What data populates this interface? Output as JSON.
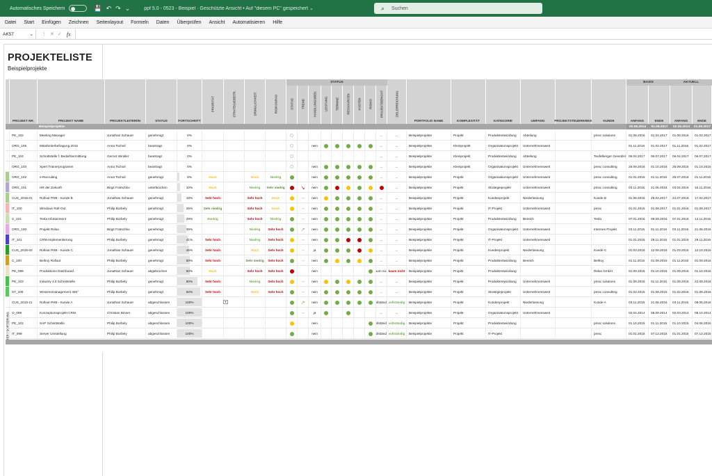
{
  "titlebar": {
    "autosave_label": "Automatisches Speichern",
    "document_title": "ppf 5.0 - 0523 - Beispiel · Geschützte Ansicht • Auf \"diesem PC\" gespeichert ⌄",
    "search_placeholder": "Suchen"
  },
  "ribbon_tabs": [
    "Datei",
    "Start",
    "Einfügen",
    "Zeichnen",
    "Seitenlayout",
    "Formeln",
    "Daten",
    "Überprüfen",
    "Ansicht",
    "Automatisieren",
    "Hilfe"
  ],
  "formula_bar": {
    "name_box": "AK57",
    "fx": "fx",
    "value": ""
  },
  "sheet": {
    "title": "PROJEKTELISTE",
    "subtitle": "Beispielprojekte"
  },
  "header": {
    "group_status": "STATUS",
    "group_basis": "BASIS",
    "group_aktuell": "AKTUELL",
    "vertical": {
      "filter": "FILTER / SORTIERUNG",
      "prioritaet": "PRIORITÄT",
      "strategie": "STRATEGIEBEITR.",
      "dringlichkeit": "DRINGLICHKEIT",
      "risiko": "RISIKOGRAD",
      "status": "STATUS",
      "trend": "TREND",
      "handlungsbedarf": "HANDLUNGSBED.",
      "leistung": "LEISTUNG",
      "termine": "TERMINE",
      "ressourcen": "RESSOURCEN",
      "kosten": "KOSTEN",
      "risiko2": "RISIKO",
      "projektbericht": "PROJEKTBERICHT",
      "zielerreichung": "ZIELERREICHUNG"
    },
    "cols": {
      "nr": "PROJEKT NR.",
      "name": "PROJEKT NAME",
      "leiter": "PROJEKTLEITER/IN",
      "status": "STATUS",
      "fortschritt": "FORTSCHRITT",
      "portfolio": "PORTFOLIO NAME",
      "komplexitaet": "KOMPLEXITÄT",
      "kategorie": "KATEGORIE",
      "umfang": "UMFANG",
      "steuerkreis": "PROJEKTSTEUERKREIS",
      "kunde": "KUNDE",
      "anfang1": "ANFANG",
      "ende1": "ENDE",
      "anfang2": "ANFANG",
      "ende2": "ENDE"
    },
    "dates": {
      "basis_start": "02.05.2014",
      "basis_end": "01.09.2017",
      "akt_start": "02.05.2014",
      "akt_end": "01.09.2017"
    }
  },
  "group_row_label": "Beispielprojekte",
  "colors": {
    "green": "#70ad47",
    "yellow": "#ffc000",
    "red": "#c00000",
    "excel_green": "#217346"
  },
  "rows": [
    {
      "strip": "",
      "nr": "PE_102",
      "name": "Meeting Manager",
      "leiter": "Jonathan Schauer",
      "status": "genehmigt",
      "fs": "0%",
      "fsv": 0,
      "prio": "",
      "strat": "",
      "dring": "",
      "risk": "",
      "st": "ring",
      "trend": "",
      "hb": "",
      "l": "",
      "t": "",
      "r": "",
      "k": "",
      "ri": "",
      "pb": "...",
      "ze": "",
      "port": "Beispielprojekte",
      "komp": "Projekt",
      "kat": "Produktentwicklung",
      "umf": "Abteilung",
      "psk": "",
      "kunde": "pmsc solutions",
      "a1": "01.08.2016",
      "e1": "01.04.2017",
      "a2": "01.08.2016",
      "e2": "01.04.2017"
    },
    {
      "strip": "",
      "nr": "ORG_105",
      "name": "Mitarbeiterbefragung 2016",
      "leiter": "Anna Tschoil",
      "status": "beantragt",
      "fs": "0%",
      "fsv": 0,
      "prio": "",
      "strat": "",
      "dring": "",
      "risk": "",
      "st": "ring",
      "trend": "",
      "hb": "nein",
      "l": "g",
      "t": "g",
      "r": "g",
      "k": "g",
      "ri": "g",
      "pb": "...",
      "ze": "",
      "port": "Beispielprojekte",
      "komp": "Kleinprojekt",
      "kat": "Organisationsprojekt",
      "umf": "Unternehmensweit",
      "psk": "",
      "kunde": "",
      "a1": "01.11.2016",
      "e1": "01.02.2017",
      "a2": "01.11.2016",
      "e2": "01.02.2017"
    },
    {
      "strip": "",
      "nr": "PE_104",
      "name": "Schnittstelle f. Bedarfsermittlung",
      "leiter": "Gernot Winkler",
      "status": "beantragt",
      "fs": "0%",
      "fsv": 0,
      "prio": "",
      "strat": "",
      "dring": "",
      "risk": "",
      "st": "ring",
      "trend": "",
      "hb": "",
      "l": "",
      "t": "",
      "r": "",
      "k": "",
      "ri": "",
      "pb": "...",
      "ze": "",
      "port": "Beispielprojekte",
      "komp": "Kleinprojekt",
      "kat": "Produktentwicklung",
      "umf": "Abteilung",
      "psk": "",
      "kunde": "Teufelberger GesmbH",
      "a1": "06.04.2017",
      "e1": "06.07.2017",
      "a2": "06.04.2017",
      "e2": "06.07.2017"
    },
    {
      "strip": "",
      "nr": "ORG_103",
      "name": "Xpert Trainerprogramm",
      "leiter": "Anna Tschoil",
      "status": "beantragt",
      "fs": "0%",
      "fsv": 0,
      "prio": "",
      "strat": "",
      "dring": "",
      "risk": "",
      "st": "ring",
      "trend": "",
      "hb": "nein",
      "l": "g",
      "t": "g",
      "r": "g",
      "k": "g",
      "ri": "g",
      "pb": "...",
      "ze": "",
      "port": "Beispielprojekte",
      "komp": "Kleinprojekt",
      "kat": "Organisationsprojekt",
      "umf": "Unternehmensweit",
      "psk": "",
      "kunde": "pmsc consulting",
      "a1": "25.09.2016",
      "e1": "01.10.2016",
      "a2": "25.09.2016",
      "e2": "01.10.2016"
    },
    {
      "strip": "#a9d08e",
      "nr": "ORG_102",
      "name": "e-Recruiting",
      "leiter": "Anna Tschoil",
      "status": "genehmigt",
      "fs": "8%",
      "fsv": 8,
      "prio": "Hoch",
      "strat": "",
      "dring": "Hoch",
      "risk": "Niedrig",
      "st": "g",
      "trend": "",
      "hb": "nein",
      "l": "g",
      "t": "g",
      "r": "g",
      "k": "g",
      "ri": "g",
      "pb": "...",
      "ze": "",
      "port": "Beispielprojekte",
      "komp": "Projekt",
      "kat": "Organisationsprojekt",
      "umf": "Unternehmensweit",
      "psk": "",
      "kunde": "pmsc consulting",
      "a1": "01.01.2016",
      "e1": "01.11.2016",
      "a2": "25.07.2016",
      "e2": "01.11.2016"
    },
    {
      "strip": "#b4a7d6",
      "nr": "ORG_101",
      "name": "HR der Zukunft",
      "leiter": "Birgit Fratschko",
      "status": "unterbrochen",
      "fs": "10%",
      "fsv": 10,
      "prio": "Hoch",
      "strat": "",
      "dring": "Niedrig",
      "risk": "Sehr niedrig",
      "st": "r",
      "trend": "↘",
      "hb": "nein",
      "l": "g",
      "t": "r",
      "r": "y",
      "k": "g",
      "ri": "y",
      "pb": "r",
      "ze": "",
      "port": "Beispielprojekte",
      "komp": "Projekt",
      "kat": "Strategieprojekt",
      "umf": "Unternehmensweit",
      "psk": "",
      "kunde": "pmsc consulting",
      "a1": "03.11.2015",
      "e1": "21.06.2016",
      "a2": "03.04.2016",
      "e2": "16.11.2016"
    },
    {
      "strip": "#a9d08e",
      "nr": "CUS_2016-01",
      "name": "Rollout PHB - Kunde B",
      "leiter": "Jonathan Schauer",
      "status": "genehmigt",
      "fs": "18%",
      "fsv": 18,
      "prio": "Sehr hoch",
      "strat": "",
      "dring": "Sehr hoch",
      "risk": "Hoch",
      "st": "y",
      "trend": "→",
      "hb": "nein",
      "l": "y",
      "t": "g",
      "r": "g",
      "k": "g",
      "ri": "g",
      "pb": "...",
      "ze": "",
      "port": "Beispielprojekte",
      "komp": "Projekt",
      "kat": "Kundenprojekt",
      "umf": "Niederlassung",
      "psk": "",
      "kunde": "Kunde B",
      "a1": "01.08.2016",
      "e1": "25.02.2017",
      "a2": "24.07.2016",
      "e2": "17.02.2017"
    },
    {
      "strip": "#f4b6b6",
      "nr": "IT_100",
      "name": "Windows Roll-Out",
      "leiter": "Philip Borbely",
      "status": "genehmigt",
      "fs": "26%",
      "fsv": 26,
      "prio": "Sehr niedrig",
      "strat": "",
      "dring": "Sehr hoch",
      "risk": "Hoch",
      "st": "y",
      "trend": "→",
      "hb": "nein",
      "l": "g",
      "t": "g",
      "r": "g",
      "k": "g",
      "ri": "g",
      "pb": "...",
      "ze": "",
      "port": "Beispielprojekte",
      "komp": "Projekt",
      "kat": "IT-Projekt",
      "umf": "Unternehmensweit",
      "psk": "",
      "kunde": "pmsc",
      "a1": "01.01.2016",
      "e1": "01.09.2017",
      "a2": "01.01.2016",
      "e2": "01.09.2017"
    },
    {
      "strip": "#c6e0b4",
      "nr": "C_101",
      "name": "Tesla Infotainment",
      "leiter": "Philip Borbely",
      "status": "genehmigt",
      "fs": "29%",
      "fsv": 29,
      "prio": "Niedrig",
      "strat": "",
      "dring": "Sehr hoch",
      "risk": "Niedrig",
      "st": "g",
      "trend": "→",
      "hb": "nein",
      "l": "g",
      "t": "g",
      "r": "g",
      "k": "g",
      "ri": "g",
      "pb": "...",
      "ze": "",
      "port": "Beispielprojekte",
      "komp": "Projekt",
      "kat": "Produktentwicklung",
      "umf": "Bereich",
      "psk": "",
      "kunde": "Tesla",
      "a1": "07.01.2016",
      "e1": "09.09.2016",
      "a2": "07.01.2016",
      "e2": "14.11.2016"
    },
    {
      "strip": "#e6a8e6",
      "nr": "ORG_100",
      "name": "Projekt Relax",
      "leiter": "Birgit Fratschko",
      "status": "genehmigt",
      "fs": "36%",
      "fsv": 36,
      "prio": "",
      "strat": "",
      "dring": "Niedrig",
      "risk": "Sehr hoch",
      "st": "g",
      "trend": "↗",
      "hb": "nein",
      "l": "g",
      "t": "g",
      "r": "g",
      "k": "g",
      "ri": "g",
      "pb": "...",
      "ze": "",
      "port": "Beispielprojekte",
      "komp": "Projekt",
      "kat": "Organisationsprojekt",
      "umf": "Unternehmensweit",
      "psk": "",
      "kunde": "Internes Projekt",
      "a1": "03.11.2015",
      "e1": "01.11.2016",
      "a2": "03.11.2015",
      "e2": "21.06.2016"
    },
    {
      "strip": "#4b3fd4",
      "nr": "IT_101",
      "name": "CRM-Implementierung",
      "leiter": "Philip Borbely",
      "status": "genehmigt",
      "fs": "41%",
      "fsv": 41,
      "prio": "Sehr hoch",
      "strat": "",
      "dring": "Niedrig",
      "risk": "Sehr hoch",
      "st": "y",
      "trend": "→",
      "hb": "nein",
      "l": "g",
      "t": "g",
      "r": "r",
      "k": "r",
      "ri": "g",
      "pb": "...",
      "ze": "",
      "port": "Beispielprojekte",
      "komp": "Projekt",
      "kat": "IT-Projekt",
      "umf": "Unternehmensweit",
      "psk": "",
      "kunde": "",
      "a1": "01.01.2016",
      "e1": "29.11.2016",
      "a2": "01.01.2016",
      "e2": "29.11.2016"
    },
    {
      "strip": "#2a9d2a",
      "nr": "CUS_2016-02",
      "name": "Rollout PHB - Kunde C",
      "leiter": "Jonathan Schauer",
      "status": "genehmigt",
      "fs": "46%",
      "fsv": 46,
      "prio": "Sehr hoch",
      "strat": "",
      "dring": "Hoch",
      "risk": "Sehr hoch",
      "st": "y",
      "trend": "→",
      "hb": "ja",
      "l": "g",
      "t": "g",
      "r": "g",
      "k": "r",
      "ri": "y",
      "pb": "...",
      "ze": "",
      "port": "Beispielprojekte",
      "komp": "Projekt",
      "kat": "Kundenprojekt",
      "umf": "Niederlassung",
      "psk": "",
      "kunde": "Kunde C",
      "a1": "01.03.2016",
      "e1": "12.09.2016",
      "a2": "01.03.2016",
      "e2": "12.10.2016"
    },
    {
      "strip": "#c9a227",
      "nr": "C_100",
      "name": "Bellroy Rollout",
      "leiter": "Philip Borbely",
      "status": "genehmigt",
      "fs": "50%",
      "fsv": 50,
      "prio": "Sehr hoch",
      "strat": "",
      "dring": "Sehr niedrig",
      "risk": "Sehr hoch",
      "st": "g",
      "trend": "→",
      "hb": "nein",
      "l": "g",
      "t": "y",
      "r": "g",
      "k": "y",
      "ri": "g",
      "pb": "...",
      "ze": "",
      "port": "Beispielprojekte",
      "komp": "Projekt",
      "kat": "Produktentwicklung",
      "umf": "Bereich",
      "psk": "",
      "kunde": "Bellroy",
      "a1": "01.11.2015",
      "e1": "01.09.2016",
      "a2": "01.11.2015",
      "e2": "01.09.2016"
    },
    {
      "strip": "#e8e4c4",
      "nr": "PE_099",
      "name": "Produktions Dashboard",
      "leiter": "Jonathan Schauer",
      "status": "abgebrochen",
      "fs": "50%",
      "fsv": 50,
      "prio": "Hoch",
      "strat": "",
      "dring": "Sehr hoch",
      "risk": "Sehr hoch",
      "st": "r",
      "trend": "",
      "hb": "nein",
      "l": "",
      "t": "",
      "r": "",
      "k": "",
      "ri": "g",
      "pb": "kaum nicht",
      "ze": "",
      "port": "Beispielprojekte",
      "komp": "Projekt",
      "kat": "Produktentwicklung",
      "umf": "",
      "psk": "",
      "kunde": "Relax GmbH",
      "a1": "01.09.2015",
      "e1": "01.10.2015",
      "a2": "01.09.2015",
      "e2": "01.10.2015"
    },
    {
      "strip": "#4bbf4b",
      "nr": "PE_103",
      "name": "Industry 4.0 Schnittstelle",
      "leiter": "Philip Borbely",
      "status": "genehmigt",
      "fs": "80%",
      "fsv": 80,
      "prio": "Sehr hoch",
      "strat": "",
      "dring": "Niedrig",
      "risk": "Sehr hoch",
      "st": "y",
      "trend": "→",
      "hb": "nein",
      "l": "y",
      "t": "g",
      "r": "y",
      "k": "g",
      "ri": "g",
      "pb": "...",
      "ze": "",
      "port": "Beispielprojekte",
      "komp": "Projekt",
      "kat": "Produktentwicklung",
      "umf": "Unternehmensweit",
      "psk": "",
      "kunde": "pmsc solutions",
      "a1": "01.09.2015",
      "e1": "01.11.2015",
      "a2": "01.09.2015",
      "e2": "22.09.2016"
    },
    {
      "strip": "#5cc95c",
      "nr": "ST_100",
      "name": "Wissensmanagement 360°",
      "leiter": "Philip Borbely",
      "status": "genehmigt",
      "fs": "92%",
      "fsv": 92,
      "prio": "Sehr hoch",
      "strat": "",
      "dring": "Hoch",
      "risk": "Sehr hoch",
      "st": "g",
      "trend": "→",
      "hb": "nein",
      "l": "g",
      "t": "g",
      "r": "g",
      "k": "g",
      "ri": "g",
      "pb": "...",
      "ze": "",
      "port": "Beispielprojekte",
      "komp": "Projekt",
      "kat": "Strategieprojekt",
      "umf": "Unternehmensweit",
      "psk": "",
      "kunde": "pmsc consulting",
      "a1": "01.02.2016",
      "e1": "01.08.2016",
      "a2": "01.02.2016",
      "e2": "01.08.2016"
    },
    {
      "strip": "",
      "nr": "CUS_2015-11",
      "name": "Rollout PHB - Kunde A",
      "leiter": "Jonathan Schauer",
      "status": "abgeschlossen",
      "fs": "100%",
      "fsv": 100,
      "prio": "",
      "strat": "",
      "dring": "",
      "risk": "",
      "st": "g",
      "trend": "↗",
      "hb": "nein",
      "l": "g",
      "t": "g",
      "r": "g",
      "k": "g",
      "ri": "g",
      "pb": "vollständig",
      "ze": "",
      "port": "Beispielprojekte",
      "komp": "Projekt",
      "kat": "Kundenprojekt",
      "umf": "Niederlassung",
      "psk": "",
      "kunde": "Kunde A",
      "a1": "03.11.2015",
      "e1": "21.06.2016",
      "a2": "03.11.2015",
      "e2": "08.05.2016"
    },
    {
      "strip": "",
      "nr": "O_099",
      "name": "Konzeptionsprojekt CRM",
      "leiter": "Christian Binner",
      "status": "abgeschlossen",
      "fs": "100%",
      "fsv": 100,
      "prio": "",
      "strat": "",
      "dring": "",
      "risk": "",
      "st": "g",
      "trend": "→",
      "hb": "ja",
      "l": "g",
      "t": "",
      "r": "g",
      "k": "",
      "ri": "",
      "pb": "...",
      "ze": "",
      "port": "Beispielprojekte",
      "komp": "Projekt",
      "kat": "Organisationsprojekt",
      "umf": "Unternehmensweit",
      "psk": "",
      "kunde": "",
      "a1": "02.04.2014",
      "e1": "08.09.2014",
      "a2": "02.03.2014",
      "e2": "08.10.2014"
    },
    {
      "strip": "",
      "nr": "PE_101",
      "name": "SAP Schnittstelle",
      "leiter": "Philip Borbely",
      "status": "abgeschlossen",
      "fs": "100%",
      "fsv": 100,
      "prio": "",
      "strat": "",
      "dring": "",
      "risk": "",
      "st": "y",
      "trend": "",
      "hb": "nein",
      "l": "",
      "t": "",
      "r": "",
      "k": "",
      "ri": "g",
      "pb": "vollständig",
      "ze": "",
      "port": "Beispielprojekte",
      "komp": "Projekt",
      "kat": "Produktentwicklung",
      "umf": "",
      "psk": "",
      "kunde": "pmsc solutions",
      "a1": "01.10.2015",
      "e1": "01.11.2015",
      "a2": "01.10.2015",
      "e2": "04.06.2016"
    },
    {
      "strip": "",
      "nr": "IT_099",
      "name": "Server Umstellung",
      "leiter": "Philip Borbely",
      "status": "abgeschlossen",
      "fs": "100%",
      "fsv": 100,
      "prio": "",
      "strat": "",
      "dring": "",
      "risk": "",
      "st": "g",
      "trend": "",
      "hb": "nein",
      "l": "",
      "t": "",
      "r": "",
      "k": "",
      "ri": "g",
      "pb": "vollständig",
      "ze": "",
      "port": "Beispielprojekte",
      "komp": "Projekt",
      "kat": "IT-Projekt",
      "umf": "",
      "psk": "",
      "kunde": "pmsc",
      "a1": "01.01.2015",
      "e1": "07.12.2015",
      "a2": "01.01.2015",
      "e2": "07.12.2015"
    }
  ]
}
